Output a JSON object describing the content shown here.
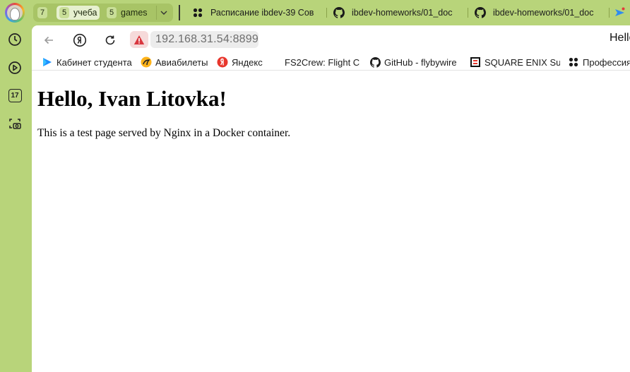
{
  "sidebar": {
    "calendar_day": "17",
    "icons": [
      "avatar",
      "clock-icon",
      "play-icon",
      "calendar-icon",
      "screenshot-icon"
    ]
  },
  "tab_groups": [
    {
      "count": "7",
      "label": ""
    },
    {
      "count": "5",
      "label": "учеба"
    },
    {
      "count": "5",
      "label": "games"
    }
  ],
  "tabs": [
    {
      "title": "Расписание ibdev-39 Сов",
      "icon": "multicolor-dots-icon"
    },
    {
      "title": "ibdev-homeworks/01_doc",
      "icon": "github-icon"
    },
    {
      "title": "ibdev-homeworks/01_doc",
      "icon": "github-icon"
    }
  ],
  "address_bar": {
    "url": "192.168.31.54:8899",
    "security": "warning",
    "page_title": "Hello"
  },
  "bookmarks": [
    {
      "label": "Кабинет студента",
      "icon": "play-blue-icon"
    },
    {
      "label": "Авиабилеты",
      "icon": "aviasales-icon"
    },
    {
      "label": "Яндекс",
      "icon": "yandex-icon"
    },
    {
      "label": "FS2Crew: Flight C",
      "icon": ""
    },
    {
      "label": "GitHub - flybywire",
      "icon": "github-icon"
    },
    {
      "label": "SQUARE ENIX Sup",
      "icon": "square-enix-icon"
    },
    {
      "label": "Профессия",
      "icon": "multicolor-dots-icon"
    }
  ],
  "page": {
    "heading": "Hello, Ivan Litovka!",
    "paragraph": "This is a test page served by Nginx in a Docker container."
  },
  "colors": {
    "chrome_green": "#b8d47a",
    "warning_red": "#d9363e"
  }
}
